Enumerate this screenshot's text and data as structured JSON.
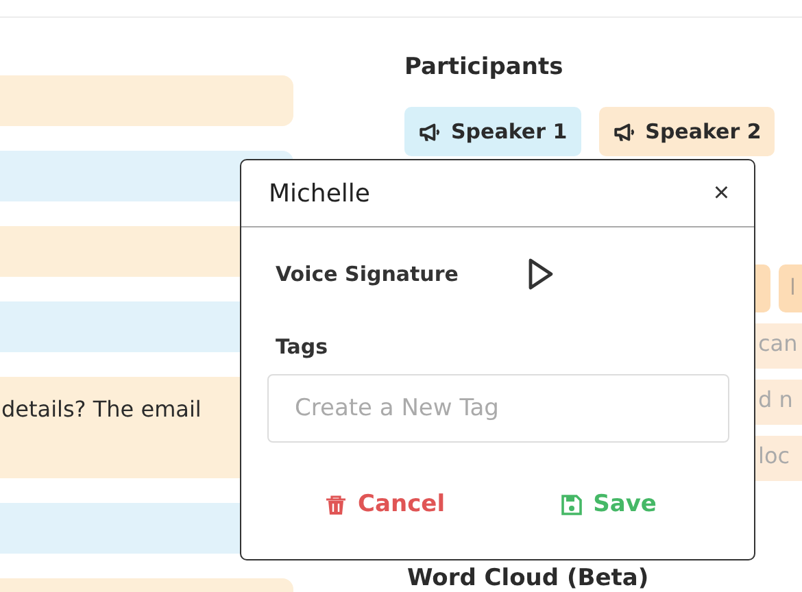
{
  "transcript": [
    {
      "color": "#fdeed7"
    },
    {
      "color": "#e1f2fa"
    },
    {
      "color": "#fdeed7"
    },
    {
      "color": "#e1f2fa"
    },
    {
      "color": "#fdeed7",
      "text": "details? The email"
    },
    {
      "color": "#e1f2fa"
    },
    {
      "color": "#fdeed7"
    }
  ],
  "participants": {
    "title": "Participants",
    "speakers": [
      {
        "label": "Speaker 1",
        "color": "#d7f0f9"
      },
      {
        "label": "Speaker 2",
        "color": "#fde9cf"
      }
    ]
  },
  "keywords": [
    {
      "kind": "tag"
    },
    {
      "kind": "tag",
      "text": "l"
    }
  ],
  "mentions": [
    {
      "text": "can"
    },
    {
      "text": "d n"
    },
    {
      "text": "loc"
    }
  ],
  "word_cloud": {
    "title": "Word Cloud (Beta)"
  },
  "modal": {
    "title": "Michelle",
    "close": "×",
    "voice_label": "Voice Signature",
    "tags_label": "Tags",
    "tag_placeholder": "Create a New Tag",
    "buttons": [
      {
        "kind": "cancel",
        "label": "Cancel"
      },
      {
        "kind": "save",
        "label": "Save"
      }
    ]
  }
}
